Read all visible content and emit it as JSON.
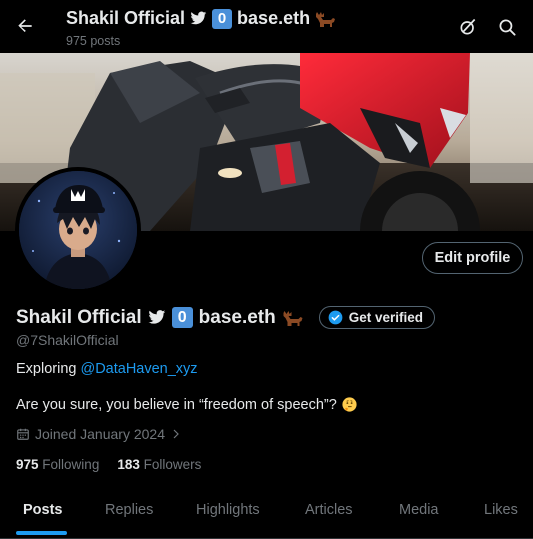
{
  "header": {
    "title": "Shakil Official",
    "badge": "0",
    "title_suffix": "base.eth",
    "post_count": "975 posts"
  },
  "profile": {
    "name": "Shakil Official",
    "badge": "0",
    "name_suffix": "base.eth",
    "handle": "@7ShakilOfficial",
    "edit_label": "Edit profile",
    "verify_label": "Get verified",
    "bio_prefix": "Exploring ",
    "bio_mention": "@DataHaven_xyz",
    "bio_line2": "Are you sure, you believe in “freedom of speech”?",
    "joined": "Joined January 2024",
    "following_count": "975",
    "following_label": "Following",
    "followers_count": "183",
    "followers_label": "Followers"
  },
  "tabs": [
    {
      "label": "Posts",
      "active": true
    },
    {
      "label": "Replies"
    },
    {
      "label": "Highlights"
    },
    {
      "label": "Articles"
    },
    {
      "label": "Media"
    },
    {
      "label": "Likes"
    }
  ],
  "colors": {
    "accent": "#1d9bf0",
    "badge": "#4a90d9",
    "muted": "#71767b",
    "text": "#e7e9ea",
    "background": "#000000"
  },
  "icons": {
    "back": "arrow-left-icon",
    "grok": "grok-icon",
    "search": "search-icon",
    "bird": "bird-icon",
    "moose": "moose-icon",
    "verified": "verified-check-icon",
    "calendar": "calendar-icon",
    "thinking": "thinking-face-emoji-icon"
  }
}
